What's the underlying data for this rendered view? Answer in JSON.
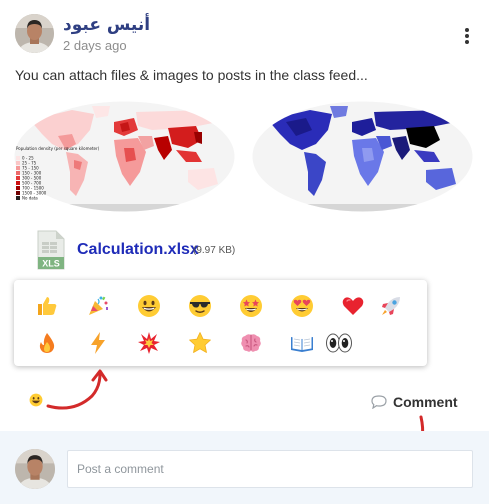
{
  "post": {
    "author_name": "أنيس عبود",
    "timestamp": "2 days ago",
    "text": "You can attach files & images to posts in the class feed...",
    "more_icon": "vertical-ellipsis-icon"
  },
  "images": {
    "left_map": {
      "legend_title": "Population density (per square kilometer)",
      "legend_items": [
        "0 - 25",
        "25 - 75",
        "75 - 150",
        "150 - 300",
        "300 - 500",
        "500 - 700",
        "700 - 1500",
        "1500 - 3000",
        "No data"
      ]
    },
    "right_map": {}
  },
  "attachment": {
    "file_name": "Calculation.xlsx",
    "file_size": "(9.97 KB)",
    "icon_label": "XLS",
    "icon": "excel-file-icon"
  },
  "reactions": [
    {
      "name": "thumbs-up",
      "icon": "thumbs-up-icon"
    },
    {
      "name": "party-popper",
      "icon": "party-popper-icon"
    },
    {
      "name": "grinning-face",
      "icon": "grinning-face-icon"
    },
    {
      "name": "sunglasses-face",
      "icon": "sunglasses-face-icon"
    },
    {
      "name": "star-struck",
      "icon": "star-struck-icon"
    },
    {
      "name": "heart-eyes",
      "icon": "heart-eyes-icon"
    },
    {
      "name": "red-heart",
      "icon": "red-heart-icon"
    },
    {
      "name": "rocket",
      "icon": "rocket-icon"
    },
    {
      "name": "fire",
      "icon": "fire-icon"
    },
    {
      "name": "lightning",
      "icon": "lightning-icon"
    },
    {
      "name": "collision",
      "icon": "collision-icon"
    },
    {
      "name": "star",
      "icon": "star-icon"
    },
    {
      "name": "brain",
      "icon": "brain-icon"
    },
    {
      "name": "open-book",
      "icon": "open-book-icon"
    },
    {
      "name": "eyes",
      "icon": "eyes-icon"
    }
  ],
  "actions": {
    "comment_label": "Comment",
    "comment_icon": "speech-bubble-icon",
    "react_icon": "smiley-reaction-icon"
  },
  "comment_box": {
    "placeholder": "Post a comment"
  },
  "colors": {
    "author": "#2f3f82",
    "file_link": "#1e2bb8",
    "annotation_arrow": "#d32a2a",
    "comment_bar_bg": "#f1f6fb"
  }
}
